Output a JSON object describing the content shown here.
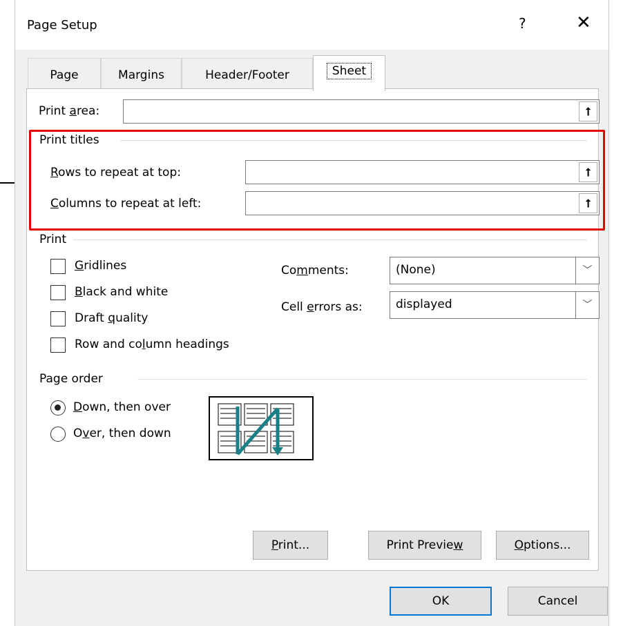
{
  "dialog": {
    "title": "Page Setup",
    "help": "?",
    "close": "✕"
  },
  "tabs": [
    {
      "label": "Page"
    },
    {
      "label": "Margins"
    },
    {
      "label": "Header/Footer"
    },
    {
      "label": "Sheet",
      "active": true
    }
  ],
  "print_area": {
    "label_pre": "Print ",
    "label_u": "a",
    "label_post": "rea:",
    "value": ""
  },
  "print_titles": {
    "heading": "Print titles",
    "rows": {
      "label_u": "R",
      "label_rest": "ows to repeat at top:",
      "value": ""
    },
    "columns": {
      "label_u": "C",
      "label_rest": "olumns to repeat at left:",
      "value": ""
    }
  },
  "print": {
    "heading": "Print",
    "gridlines": {
      "u": "G",
      "rest": "ridlines",
      "checked": false
    },
    "black_white": {
      "u": "B",
      "rest": "lack and white",
      "checked": false
    },
    "draft": {
      "pre": "Draft ",
      "u": "q",
      "rest": "uality",
      "checked": false
    },
    "headings": {
      "pre": "Row and co",
      "u": "l",
      "rest": "umn headings",
      "checked": false
    },
    "comments": {
      "pre": "Co",
      "u": "m",
      "rest": "ments:",
      "value": "(None)"
    },
    "cell_errors": {
      "pre": "Cell ",
      "u": "e",
      "rest": "rrors as:",
      "value": "displayed"
    }
  },
  "page_order": {
    "heading": "Page order",
    "down_over": {
      "u": "D",
      "rest": "own, then over",
      "selected": true
    },
    "over_down": {
      "pre": "O",
      "u": "v",
      "rest": "er, then down",
      "selected": false
    }
  },
  "buttons": {
    "print": {
      "u": "P",
      "rest": "rint..."
    },
    "preview": {
      "pre": "Print Previe",
      "u": "w",
      "rest": ""
    },
    "options": {
      "u": "O",
      "rest": "ptions..."
    },
    "ok": "OK",
    "cancel": "Cancel"
  },
  "colors": {
    "highlight": "#e60000",
    "accent": "#0078d7",
    "order_arrow": "#1a7f86"
  },
  "icons": {
    "collapse": "collapse-dialog-icon",
    "dropdown": "chevron-down-icon",
    "order": "page-order-icon"
  }
}
